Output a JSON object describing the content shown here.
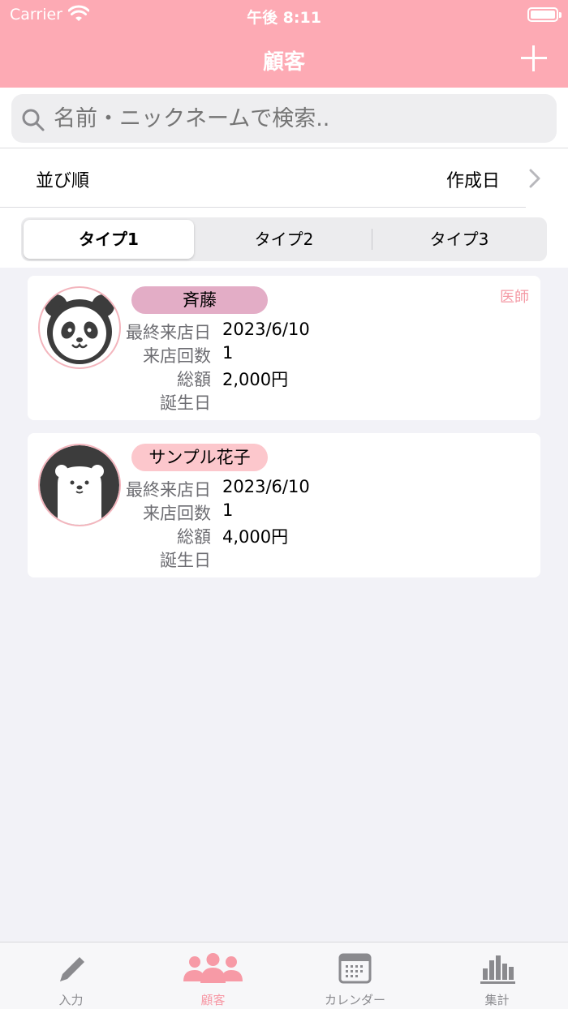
{
  "status_bar": {
    "carrier": "Carrier",
    "time": "午後 8:11"
  },
  "nav": {
    "title": "顧客"
  },
  "search": {
    "placeholder": "名前・ニックネームで検索.."
  },
  "sort": {
    "label": "並び順",
    "value": "作成日"
  },
  "segments": [
    {
      "label": "タイプ1",
      "selected": true
    },
    {
      "label": "タイプ2",
      "selected": false
    },
    {
      "label": "タイプ3",
      "selected": false
    }
  ],
  "field_labels": {
    "last_visit": "最終来店日",
    "visit_count": "来店回数",
    "total": "総額",
    "birthday": "誕生日"
  },
  "customers": [
    {
      "name": "斉藤",
      "badge_color": "#e3adc6",
      "tag": "医師",
      "last_visit": "2023/6/10",
      "visit_count": "1",
      "total": "2,000円",
      "birthday": "",
      "avatar": "panda-icon"
    },
    {
      "name": "サンプル花子",
      "badge_color": "#fcc7cc",
      "tag": "",
      "last_visit": "2023/6/10",
      "visit_count": "1",
      "total": "4,000円",
      "birthday": "",
      "avatar": "bear-icon"
    }
  ],
  "tabs": [
    {
      "label": "入力",
      "icon": "pencil-icon"
    },
    {
      "label": "顧客",
      "icon": "people-icon",
      "active": true
    },
    {
      "label": "カレンダー",
      "icon": "calendar-icon"
    },
    {
      "label": "集計",
      "icon": "bar-chart-icon"
    }
  ],
  "colors": {
    "accent": "#fdaab4",
    "background": "#f2f2f7"
  }
}
